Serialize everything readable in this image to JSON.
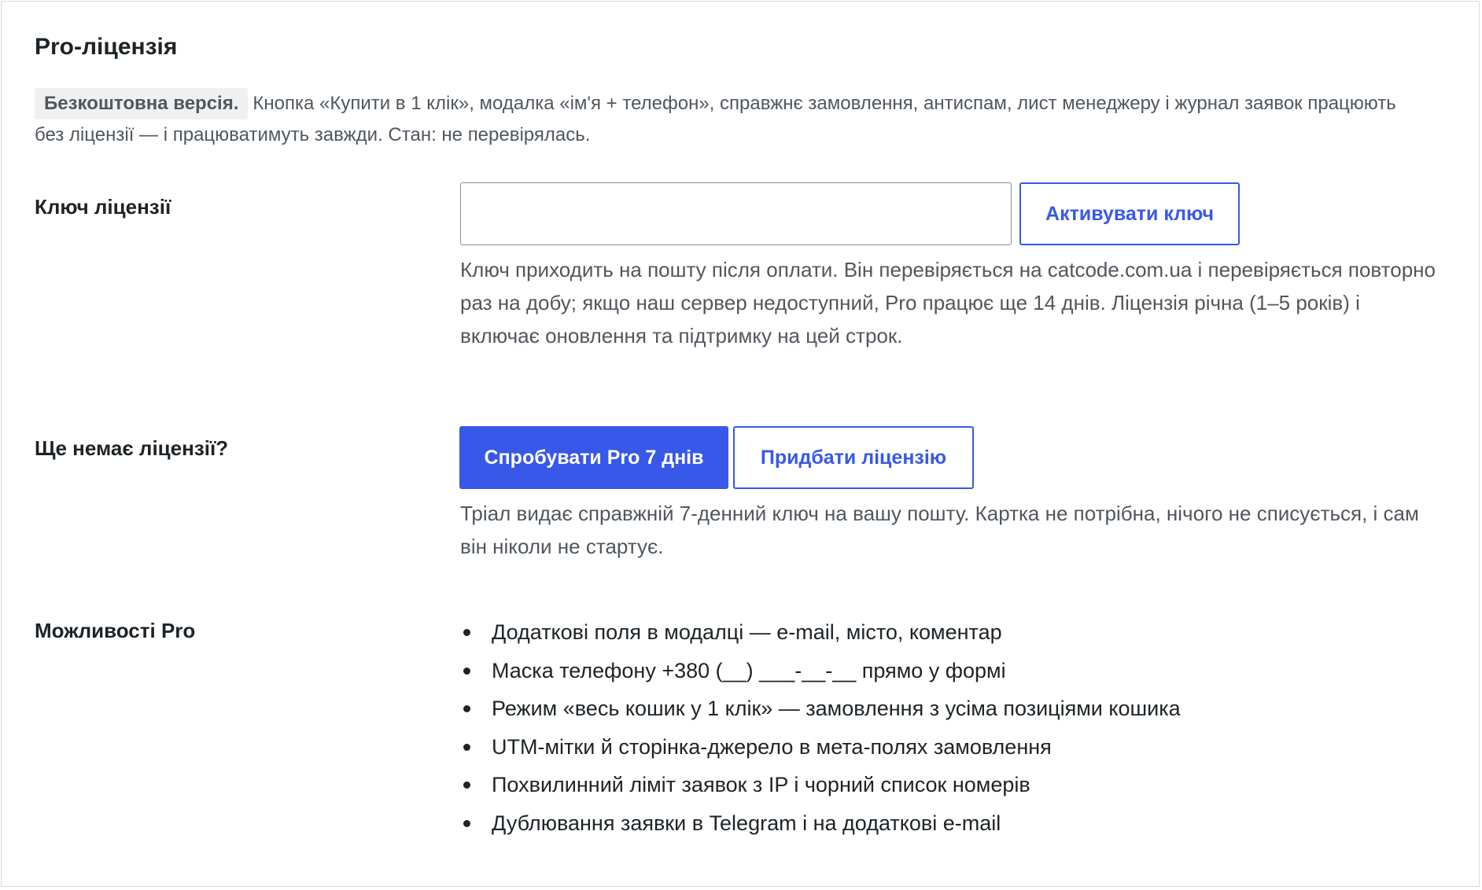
{
  "page": {
    "title": "Pro-ліцензія"
  },
  "intro": {
    "badge": "Безкоштовна версія.",
    "text": "Кнопка «Купити в 1 клік», модалка «ім'я + телефон», справжнє замовлення, антиспам, лист менеджеру і журнал заявок працюють без ліцензії — і працюватимуть завжди. Стан: не перевірялась."
  },
  "license_key": {
    "label": "Ключ ліцензії",
    "input_value": "",
    "input_placeholder": "",
    "activate_label": "Активувати ключ",
    "help": "Ключ приходить на пошту після оплати. Він перевіряється на catcode.com.ua і перевіряється повторно раз на добу; якщо наш сервер недоступний, Pro працює ще 14 днів. Ліцензія річна (1–5 років) і включає оновлення та підтримку на цей строк."
  },
  "no_license": {
    "label": "Ще немає ліцензії?",
    "trial_label": "Спробувати Pro 7 днів",
    "buy_label": "Придбати ліцензію",
    "help": "Тріал видає справжній 7-денний ключ на вашу пошту. Картка не потрібна, нічого не списується, і сам він ніколи не стартує."
  },
  "features": {
    "label": "Можливості Pro",
    "items": [
      "Додаткові поля в модалці — e-mail, місто, коментар",
      "Маска телефону +380 (__) ___-__-__ прямо у формі",
      "Режим «весь кошик у 1 клік» — замовлення з усіма позиціями кошика",
      "UTM-мітки й сторінка-джерело в мета-полях замовлення",
      "Похвилинний ліміт заявок з IP і чорний список номерів",
      "Дублювання заявки в Telegram і на додаткові e-mail"
    ]
  },
  "colors": {
    "accent": "#3858e9",
    "text": "#1d2327",
    "muted_text": "#50575e",
    "badge_bg": "#f0f0f1",
    "border": "#dcdcde"
  }
}
